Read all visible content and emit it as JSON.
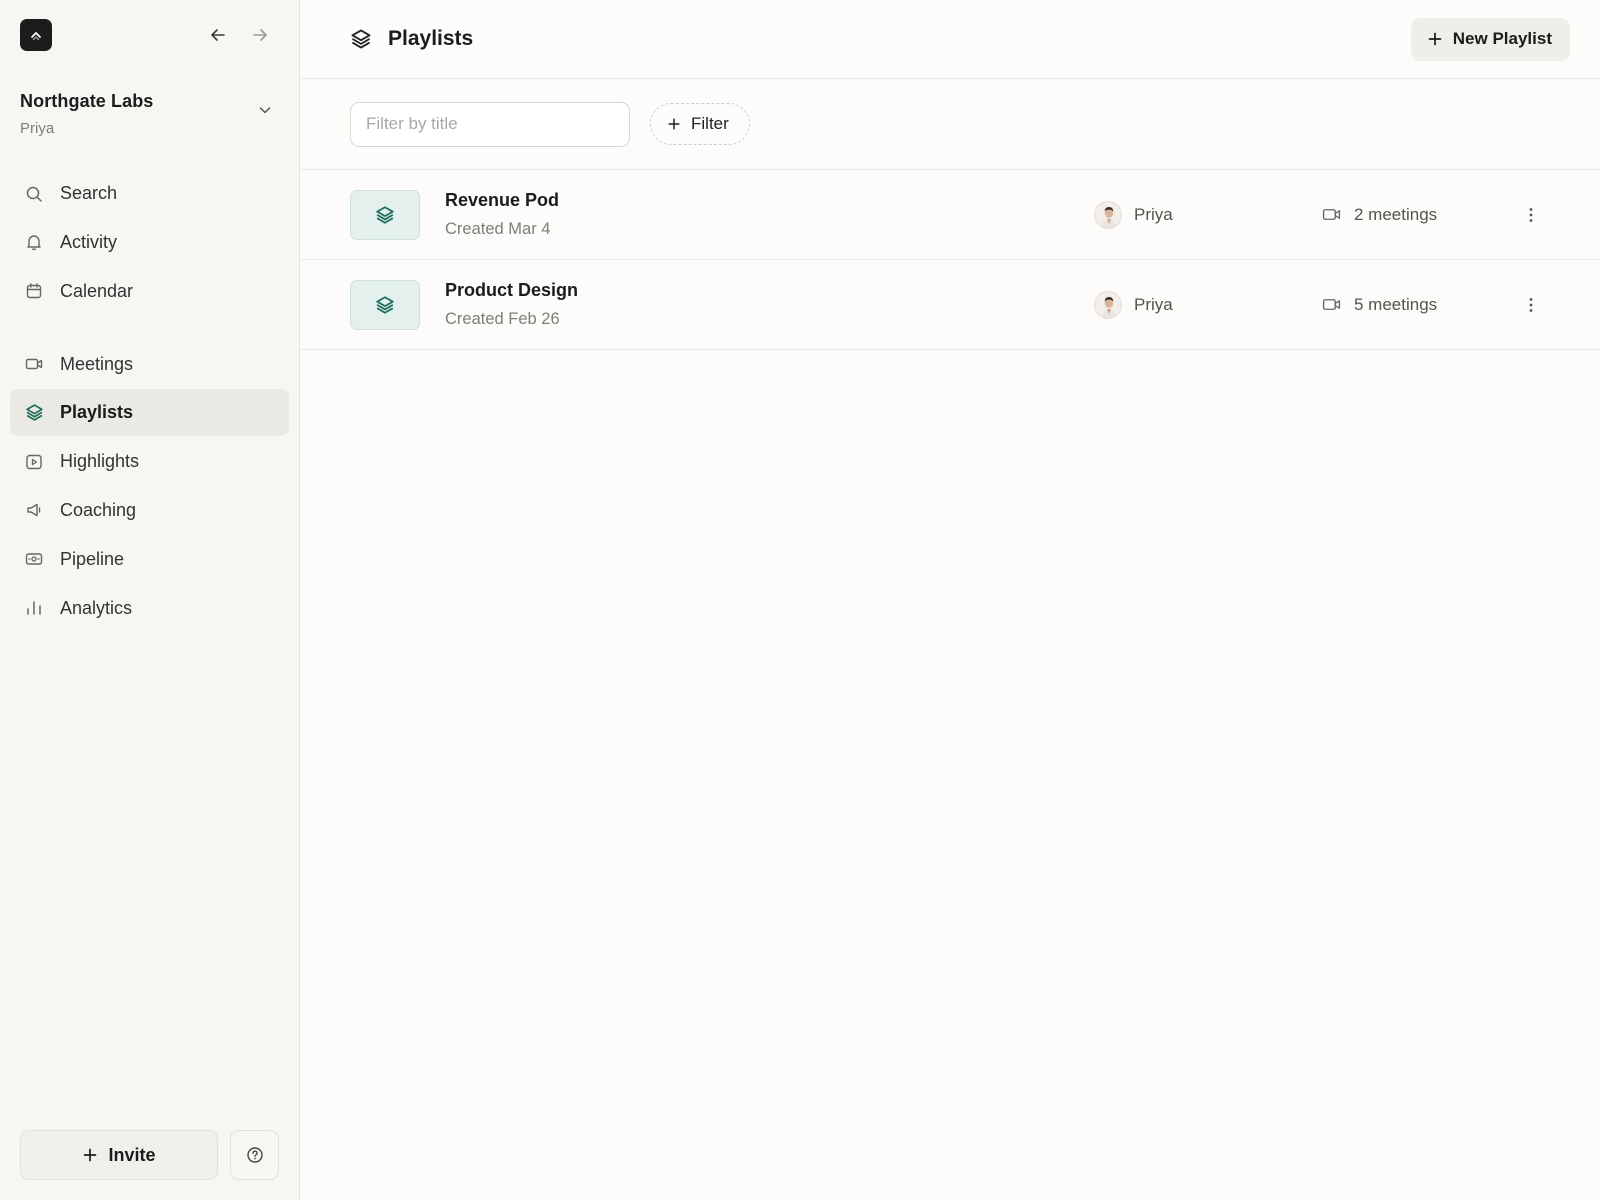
{
  "app": {
    "logo_icon": "chevron-up-logo-icon",
    "back_icon": "arrow-left-icon",
    "forward_icon": "arrow-right-icon"
  },
  "workspace": {
    "name": "Northgate Labs",
    "user": "Priya"
  },
  "sidebar": {
    "primary": [
      {
        "label": "Search",
        "icon": "search-icon"
      },
      {
        "label": "Activity",
        "icon": "bell-icon"
      },
      {
        "label": "Calendar",
        "icon": "calendar-icon"
      }
    ],
    "secondary": [
      {
        "label": "Meetings",
        "icon": "video-icon"
      },
      {
        "label": "Playlists",
        "icon": "layers-icon",
        "active": true
      },
      {
        "label": "Highlights",
        "icon": "play-square-icon"
      },
      {
        "label": "Coaching",
        "icon": "megaphone-icon"
      },
      {
        "label": "Pipeline",
        "icon": "pipeline-icon"
      },
      {
        "label": "Analytics",
        "icon": "bar-chart-icon"
      }
    ],
    "invite_label": "Invite",
    "help_icon": "help-circle-icon"
  },
  "header": {
    "title": "Playlists",
    "new_button_label": "New Playlist"
  },
  "filters": {
    "search_placeholder": "Filter by title",
    "search_value": "",
    "filter_button_label": "Filter"
  },
  "playlists": [
    {
      "title": "Revenue Pod",
      "created": "Created Mar 4",
      "owner": "Priya",
      "meetings": "2 meetings"
    },
    {
      "title": "Product Design",
      "created": "Created Feb 26",
      "owner": "Priya",
      "meetings": "5 meetings"
    }
  ],
  "colors": {
    "accent": "#1f6f5c",
    "accent_bg": "#e4f0ee",
    "active_nav_bg": "#ebe9e4",
    "sidebar_bg": "#f7f6f3",
    "main_bg": "#fdfcfa"
  }
}
